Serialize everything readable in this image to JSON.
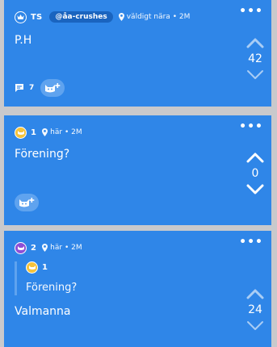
{
  "posts": [
    {
      "user_name": "TS",
      "channel": "@åa-crushes",
      "location": "väldigt nära • 2M",
      "body": "P.H",
      "votes": "42",
      "comments": "7",
      "avatar_color": "#2f86e8"
    },
    {
      "user_name": "1",
      "location": "här • 2M",
      "body": "Förening?",
      "votes": "0",
      "avatar_color": "#f5c33b"
    },
    {
      "user_name": "2",
      "location": "här • 2M",
      "quote_user": "1",
      "quote_text": "Förening?",
      "body": "Valmanna",
      "votes": "24",
      "avatar_color": "#8e4fd6"
    }
  ],
  "more_label": "•••",
  "colors": {
    "card": "#2f86e8",
    "chip": "#1a64bf",
    "react": "#5fa3ef",
    "background": "#c9c9cc"
  }
}
